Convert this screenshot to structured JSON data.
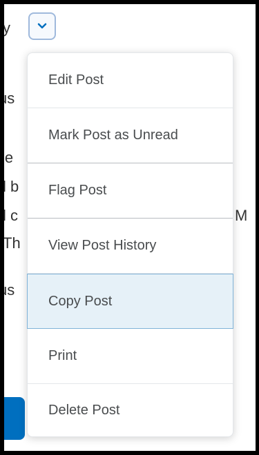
{
  "background_text": {
    "line1": "y",
    "line2": "us",
    "line3": "ie",
    "line4": "l b",
    "line5": "l c",
    "line6": "Th",
    "line7": "us",
    "right1": "M"
  },
  "menu": {
    "items": [
      {
        "label": "Edit Post"
      },
      {
        "label": "Mark Post as Unread"
      },
      {
        "label": "Flag Post"
      },
      {
        "label": "View Post History"
      },
      {
        "label": "Copy Post"
      },
      {
        "label": "Print"
      },
      {
        "label": "Delete Post"
      }
    ],
    "selected_index": 4
  },
  "colors": {
    "accent": "#006fbf",
    "selected_bg": "#e6f1f8",
    "selected_border": "#7fb3d8",
    "text": "#494c4e"
  },
  "icons": {
    "toggle": "chevron-down-icon"
  }
}
